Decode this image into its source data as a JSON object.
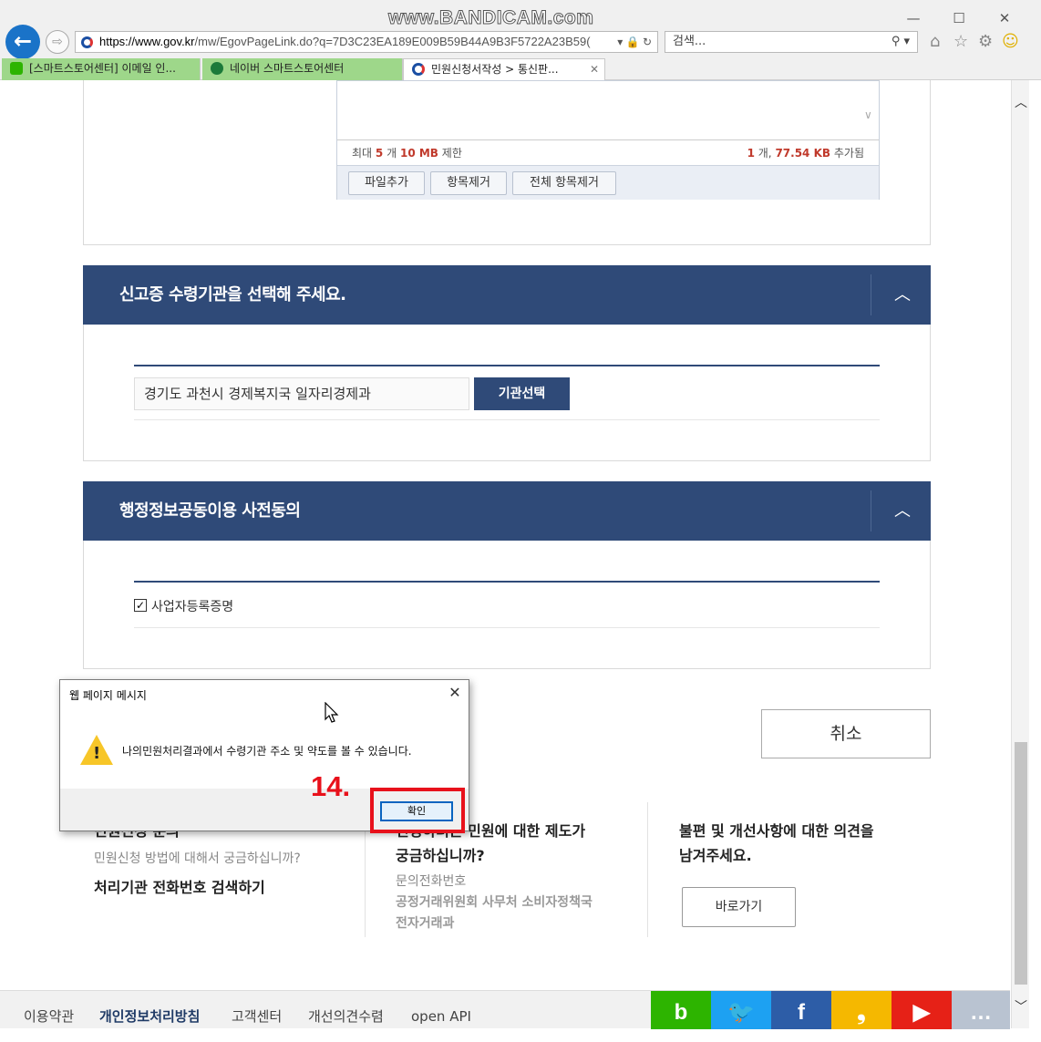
{
  "browser": {
    "watermark": "www.BANDICAM.com",
    "url_host": "https://www.gov.kr",
    "url_rest": "/mw/EgovPageLink.do?q=7D3C23EA189E009B59B44A9B3F5722A23B59(",
    "search_placeholder": "검색...",
    "tabs": [
      {
        "label": "[스마트스토어센터] 이메일 인..."
      },
      {
        "label": "네이버 스마트스토어센터"
      },
      {
        "label": "민원신청서작성 > 통신판..."
      }
    ]
  },
  "attachment": {
    "limit_prefix": "최대",
    "limit_count": "5",
    "limit_mid": "개",
    "limit_size": "10 MB",
    "limit_suffix": "제한",
    "added_count": "1",
    "added_mid": "개,",
    "added_size": "77.54 KB",
    "added_suffix": "추가됨",
    "buttons": [
      "파일추가",
      "항목제거",
      "전체 항목제거"
    ]
  },
  "section1": {
    "title": "신고증 수령기관을 선택해 주세요.",
    "org_value": "경기도 과천시 경제복지국 일자리경제과",
    "select_button": "기관선택"
  },
  "section2": {
    "title": "행정정보공동이용 사전동의",
    "checkbox_label": "사업자등록증명",
    "checkbox_checked": true
  },
  "cancel_button": "취소",
  "info": {
    "col1_title": "민원신청 문의",
    "col1_sub": "민원신청 방법에 대해서 궁금하십니까?",
    "col1_link": "처리기관 전화번호 검색하기",
    "col2_title_line1": "신청하려는 민원에 대한 제도가",
    "col2_title_line2": "궁금하십니까?",
    "col2_sub": "문의전화번호",
    "col2_line1": "공정거래위원회 사무처 소비자정책국",
    "col2_line2": "전자거래과",
    "col3_title_line1": "불편 및 개선사항에 대한 의견을",
    "col3_title_line2": "남겨주세요.",
    "col3_button": "바로가기"
  },
  "footer": {
    "links": [
      "이용약관",
      "개인정보처리방침",
      "고객센터",
      "개선의견수렴",
      "open API"
    ],
    "social": [
      {
        "name": "blog",
        "glyph": "b",
        "color": "#2db400"
      },
      {
        "name": "twitter",
        "glyph": "🐦",
        "color": "#1da1f2"
      },
      {
        "name": "facebook",
        "glyph": "f",
        "color": "#2d5da7"
      },
      {
        "name": "kakao-story",
        "glyph": "❟",
        "color": "#f5b800"
      },
      {
        "name": "youtube",
        "glyph": "▶",
        "color": "#e62117"
      },
      {
        "name": "talk",
        "glyph": "…",
        "color": "#b9c3d1"
      }
    ]
  },
  "dialog": {
    "title": "웹 페이지 메시지",
    "message": "나의민원처리결과에서 수령기관 주소 및 약도를 볼 수 있습니다.",
    "ok_button": "확인"
  },
  "annotation": {
    "step": "14."
  },
  "colors": {
    "header_navy": "#2f4a78",
    "annotation_red": "#e8111b",
    "warning_yellow": "#f7c628"
  }
}
